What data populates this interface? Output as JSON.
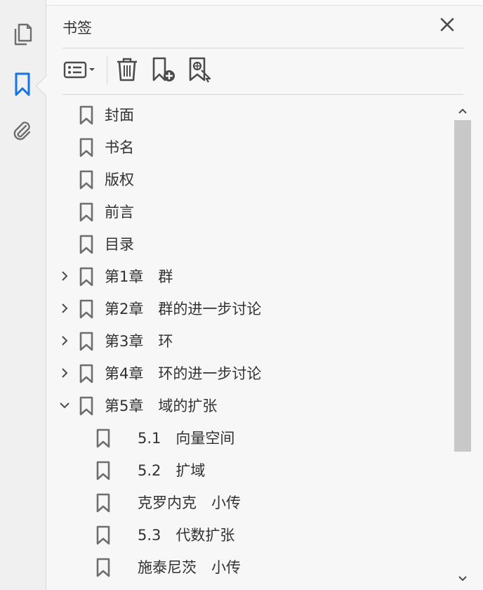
{
  "panel": {
    "title": "书签",
    "close_icon": "close-icon",
    "accent_color": "#1473e6"
  },
  "left_rail": {
    "items": [
      {
        "name": "pages",
        "icon": "page-thumbnails-icon",
        "active": false
      },
      {
        "name": "bookmarks",
        "icon": "bookmark-icon",
        "active": true
      },
      {
        "name": "attachments",
        "icon": "paperclip-icon",
        "active": false
      }
    ]
  },
  "toolbar": {
    "options_icon": "options-menu-icon",
    "delete_icon": "trash-icon",
    "new_bookmark_icon": "new-bookmark-icon",
    "find_bookmark_icon": "find-bookmark-icon"
  },
  "bookmarks": [
    {
      "label": "封面",
      "level": 0,
      "expander": "none"
    },
    {
      "label": "书名",
      "level": 0,
      "expander": "none"
    },
    {
      "label": "版权",
      "level": 0,
      "expander": "none"
    },
    {
      "label": "前言",
      "level": 0,
      "expander": "none"
    },
    {
      "label": "目录",
      "level": 0,
      "expander": "none"
    },
    {
      "label": "第1章　群",
      "level": 0,
      "expander": "collapsed"
    },
    {
      "label": "第2章　群的进一步讨论",
      "level": 0,
      "expander": "collapsed"
    },
    {
      "label": "第3章　环",
      "level": 0,
      "expander": "collapsed"
    },
    {
      "label": "第4章　环的进一步讨论",
      "level": 0,
      "expander": "collapsed"
    },
    {
      "label": "第5章　域的扩张",
      "level": 0,
      "expander": "expanded"
    },
    {
      "label": "5.1　向量空间",
      "level": 1,
      "expander": "none"
    },
    {
      "label": "5.2　扩域",
      "level": 1,
      "expander": "none"
    },
    {
      "label": "克罗内克　小传",
      "level": 1,
      "expander": "none"
    },
    {
      "label": "5.3　代数扩张",
      "level": 1,
      "expander": "none"
    },
    {
      "label": "施泰尼茨　小传",
      "level": 1,
      "expander": "none"
    }
  ],
  "scrollbar": {
    "up_icon": "scroll-up-icon",
    "down_icon": "scroll-down-icon"
  }
}
